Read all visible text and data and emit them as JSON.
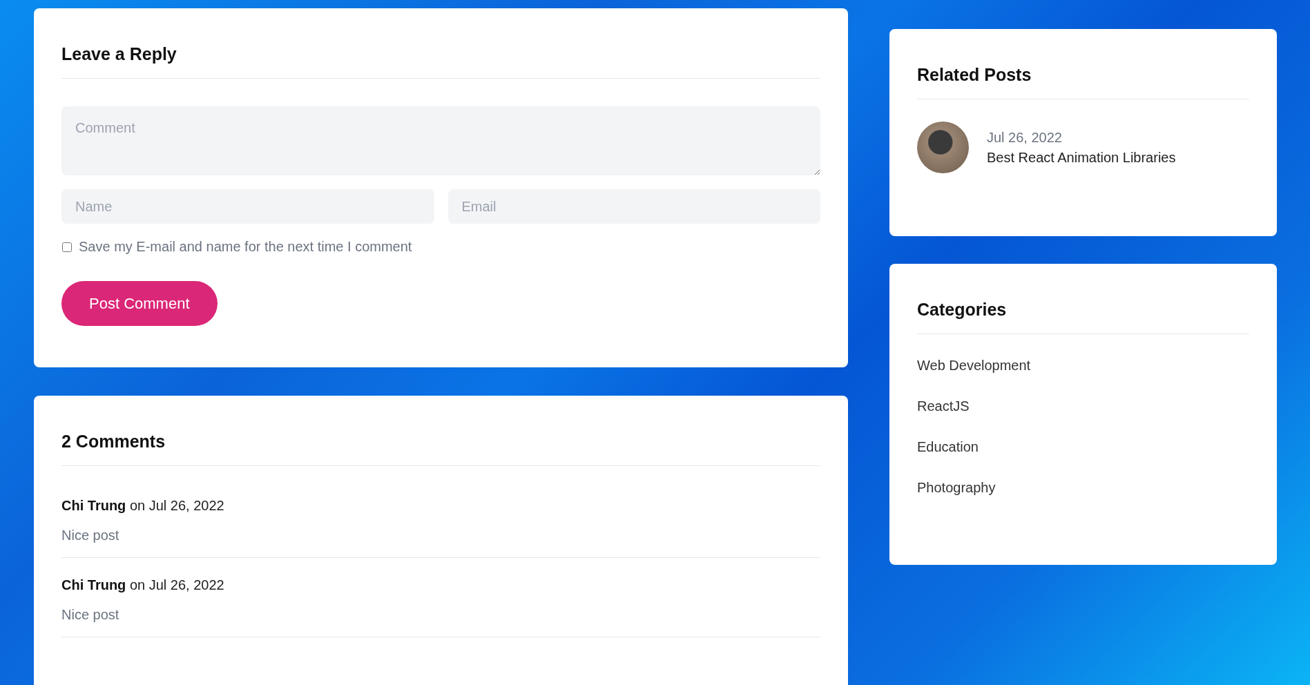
{
  "reply_form": {
    "title": "Leave a Reply",
    "comment": {
      "placeholder": "Comment"
    },
    "name": {
      "placeholder": "Name"
    },
    "email": {
      "placeholder": "Email"
    },
    "save_info": {
      "label": "Save my E-mail and name for the next time I comment",
      "checked": false
    },
    "submit": "Post Comment"
  },
  "comments": {
    "title": "2 Comments",
    "items": [
      {
        "byline": "**Chi Trung** on Jul 26, 2022",
        "text": "Nice post"
      },
      {
        "byline": "**Chi Trung** on Jul 26, 2022",
        "text": "Nice post"
      }
    ]
  },
  "related_posts": {
    "title": "Related Posts",
    "items": [
      {
        "date": "Jul 26, 2022",
        "title": "Best React Animation Libraries"
      }
    ]
  },
  "categories": {
    "title": "Categories",
    "items": [
      "Web Development",
      "ReactJS",
      "Education",
      "Photography"
    ]
  }
}
